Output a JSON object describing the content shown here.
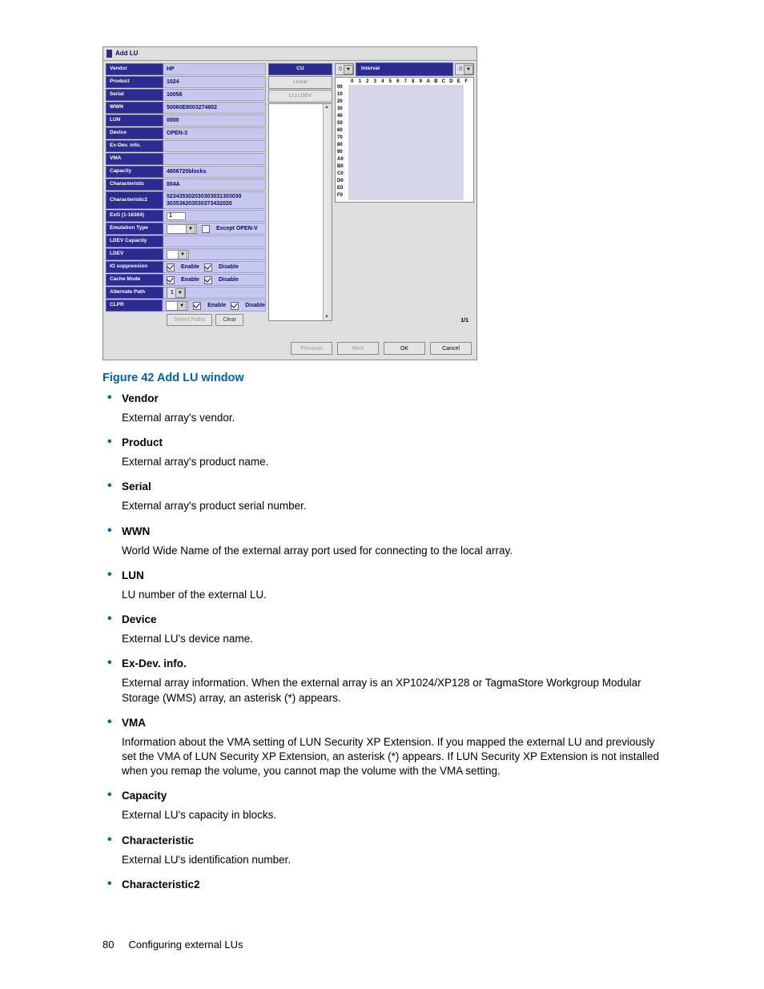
{
  "dialog": {
    "title": "Add LU",
    "rows": {
      "vendor": {
        "label": "Vendor",
        "value": "HP"
      },
      "product": {
        "label": "Product",
        "value": "1024"
      },
      "serial": {
        "label": "Serial",
        "value": "10056"
      },
      "wwn": {
        "label": "WWN",
        "value": "50060E8003274802"
      },
      "lun": {
        "label": "LUN",
        "value": "0000"
      },
      "device": {
        "label": "Device",
        "value": "OPEN-3"
      },
      "exdev": {
        "label": "Ex-Dev. info.",
        "value": ""
      },
      "vma": {
        "label": "VMA",
        "value": ""
      },
      "capacity": {
        "label": "Capacity",
        "value": "4806720blocks"
      },
      "char": {
        "label": "Characteristic",
        "value": "004A"
      },
      "char2": {
        "label": "Characteristic2",
        "value": "523435302030303031303030\n303536203030373432020"
      },
      "exg": {
        "label": "ExG (1-16384)",
        "value": "1"
      },
      "emu": {
        "label": "Emulation Type",
        "cb": "Except OPEN-V"
      },
      "ldevcap": {
        "label": "LDEV Capacity",
        "value": ""
      },
      "ldev": {
        "label": "LDEV",
        "value": ""
      },
      "iosup": {
        "label": "IO suppression",
        "en": "Enable",
        "dis": "Disable"
      },
      "cache": {
        "label": "Cache Mode",
        "en": "Enable",
        "dis": "Disable"
      },
      "altpath": {
        "label": "Alternate Path",
        "value": "1"
      },
      "clpr": {
        "label": "CLPR",
        "en": "Enable",
        "dis": "Disable"
      }
    },
    "btns": {
      "select_paths": "Select Paths",
      "clear": "Clear"
    },
    "mid": {
      "cu": "CU",
      "linear": "Linear",
      "culdev": "CU:LDEV"
    },
    "grid": {
      "interval": "Interval",
      "interval_val": "0",
      "top_val": "0",
      "cols": [
        "0",
        "1",
        "2",
        "3",
        "4",
        "5",
        "6",
        "7",
        "8",
        "9",
        "A",
        "B",
        "C",
        "D",
        "E",
        "F"
      ],
      "rows": [
        "00",
        "10",
        "20",
        "30",
        "40",
        "50",
        "60",
        "70",
        "80",
        "90",
        "A0",
        "B0",
        "C0",
        "D0",
        "E0",
        "F0"
      ]
    },
    "pager": "1/1",
    "footer": {
      "previous": "Previous",
      "next": "Next",
      "ok": "OK",
      "cancel": "Cancel"
    }
  },
  "caption": "Figure 42 Add LU window",
  "defs": [
    {
      "term": "Vendor",
      "desc": "External array's vendor."
    },
    {
      "term": "Product",
      "desc": "External array's product name."
    },
    {
      "term": "Serial",
      "desc": "External array's product serial number."
    },
    {
      "term": "WWN",
      "desc": "World Wide Name of the external array port used for connecting to the local array."
    },
    {
      "term": "LUN",
      "desc": "LU number of the external LU."
    },
    {
      "term": "Device",
      "desc": "External LU's device name."
    },
    {
      "term": "Ex-Dev. info.",
      "desc": "External array information. When the external array is an XP1024/XP128 or TagmaStore Workgroup Modular Storage (WMS) array, an asterisk (*) appears."
    },
    {
      "term": "VMA",
      "desc": "Information about the VMA setting of LUN Security XP Extension. If you mapped the external LU and previously set the VMA of LUN Security XP Extension, an asterisk (*) appears. If LUN Security XP Extension is not installed when you remap the volume, you cannot map the volume with the VMA setting."
    },
    {
      "term": "Capacity",
      "desc": "External LU's capacity in blocks."
    },
    {
      "term": "Characteristic",
      "desc": "External LU's identification number."
    },
    {
      "term": "Characteristic2",
      "desc": ""
    }
  ],
  "footer": {
    "page": "80",
    "section": "Configuring external LUs"
  }
}
